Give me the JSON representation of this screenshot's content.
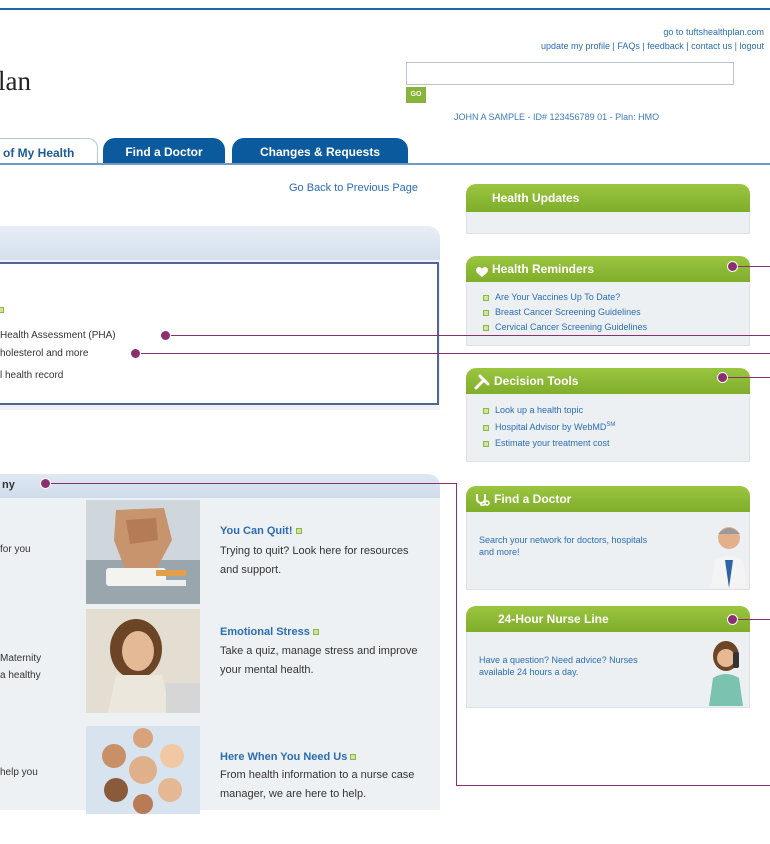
{
  "header": {
    "plan_title": "lan",
    "site_link": "go to tuftshealthplan.com",
    "util_links": "update my profile | FAQs | feedback | contact us | logout",
    "search_placeholder": "",
    "go_label": "GO",
    "member_info": "JOHN A SAMPLE - ID# 123456789 01 - Plan: HMO"
  },
  "tabs": [
    {
      "label": "of My Health"
    },
    {
      "label": "Find a Doctor"
    },
    {
      "label": "Changes & Requests"
    }
  ],
  "main": {
    "back_link": "Go Back to Previous Page",
    "panel1_items": [
      "Health Assessment (PHA)",
      "holesterol and more",
      "l health record"
    ],
    "panel2_title": "ny",
    "left_snippets": [
      "for you",
      "Maternity",
      "a healthy",
      "help you"
    ],
    "features": [
      {
        "title": "You Can Quit!",
        "desc": "Trying to quit? Look here for resources and support."
      },
      {
        "title": "Emotional Stress",
        "desc": "Take a quiz, manage stress and improve your mental health."
      },
      {
        "title": "Here When You Need Us",
        "desc": "From health information to a nurse case manager, we are here to help."
      }
    ]
  },
  "sidebar": {
    "health_updates": {
      "title": "Health Updates"
    },
    "health_reminders": {
      "title": "Health Reminders",
      "items": [
        "Are Your Vaccines Up To Date?",
        "Breast Cancer Screening Guidelines",
        "Cervical Cancer Screening Guidelines"
      ]
    },
    "decision_tools": {
      "title": "Decision Tools",
      "items": [
        "Look up a health topic",
        "Hospital Advisor by WebMD",
        "Estimate your treatment cost"
      ],
      "sm_mark": "SM"
    },
    "find_doctor": {
      "title": "Find a Doctor",
      "desc": "Search your network for doctors, hospitals and more!"
    },
    "nurse_line": {
      "title": "24-Hour Nurse Line",
      "desc": "Have a question? Need advice? Nurses available 24 hours a day."
    }
  },
  "colors": {
    "tab_blue": "#0c5a9e",
    "widget_green": "#8ab33a",
    "callout": "#8c2f6f",
    "link": "#2a6db5"
  }
}
